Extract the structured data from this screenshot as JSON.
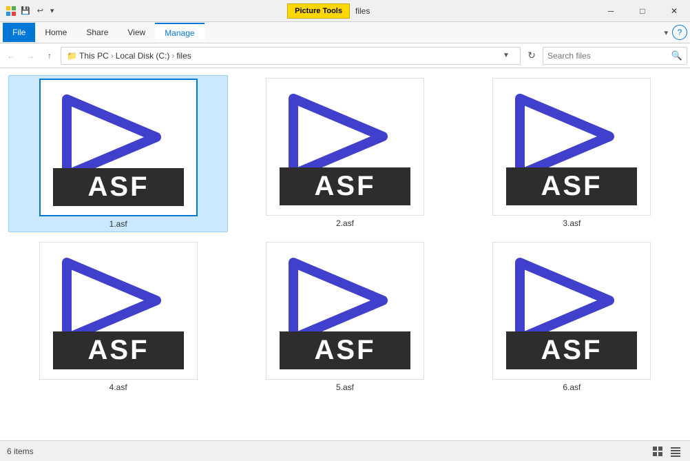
{
  "titlebar": {
    "app_title": "files",
    "ribbon_tab_title": "Picture Tools",
    "controls": {
      "minimize": "─",
      "maximize": "□",
      "close": "✕"
    }
  },
  "ribbon": {
    "tabs": [
      {
        "id": "file",
        "label": "File",
        "type": "file"
      },
      {
        "id": "home",
        "label": "Home",
        "type": "normal"
      },
      {
        "id": "share",
        "label": "Share",
        "type": "normal"
      },
      {
        "id": "view",
        "label": "View",
        "type": "normal"
      },
      {
        "id": "manage",
        "label": "Manage",
        "type": "active"
      }
    ]
  },
  "addressbar": {
    "path": [
      {
        "label": "This PC"
      },
      {
        "label": "Local Disk (C:)"
      },
      {
        "label": "files"
      }
    ],
    "search_placeholder": "Search files"
  },
  "files": [
    {
      "name": "1.asf",
      "selected": true
    },
    {
      "name": "2.asf",
      "selected": false
    },
    {
      "name": "3.asf",
      "selected": false
    },
    {
      "name": "4.asf",
      "selected": false
    },
    {
      "name": "5.asf",
      "selected": false
    },
    {
      "name": "6.asf",
      "selected": false
    }
  ],
  "statusbar": {
    "count_label": "6 items"
  },
  "colors": {
    "play_icon_stroke": "#4040cc",
    "play_icon_fill": "none",
    "asf_badge_bg": "#2d2d2d",
    "asf_badge_text": "#ffffff"
  }
}
